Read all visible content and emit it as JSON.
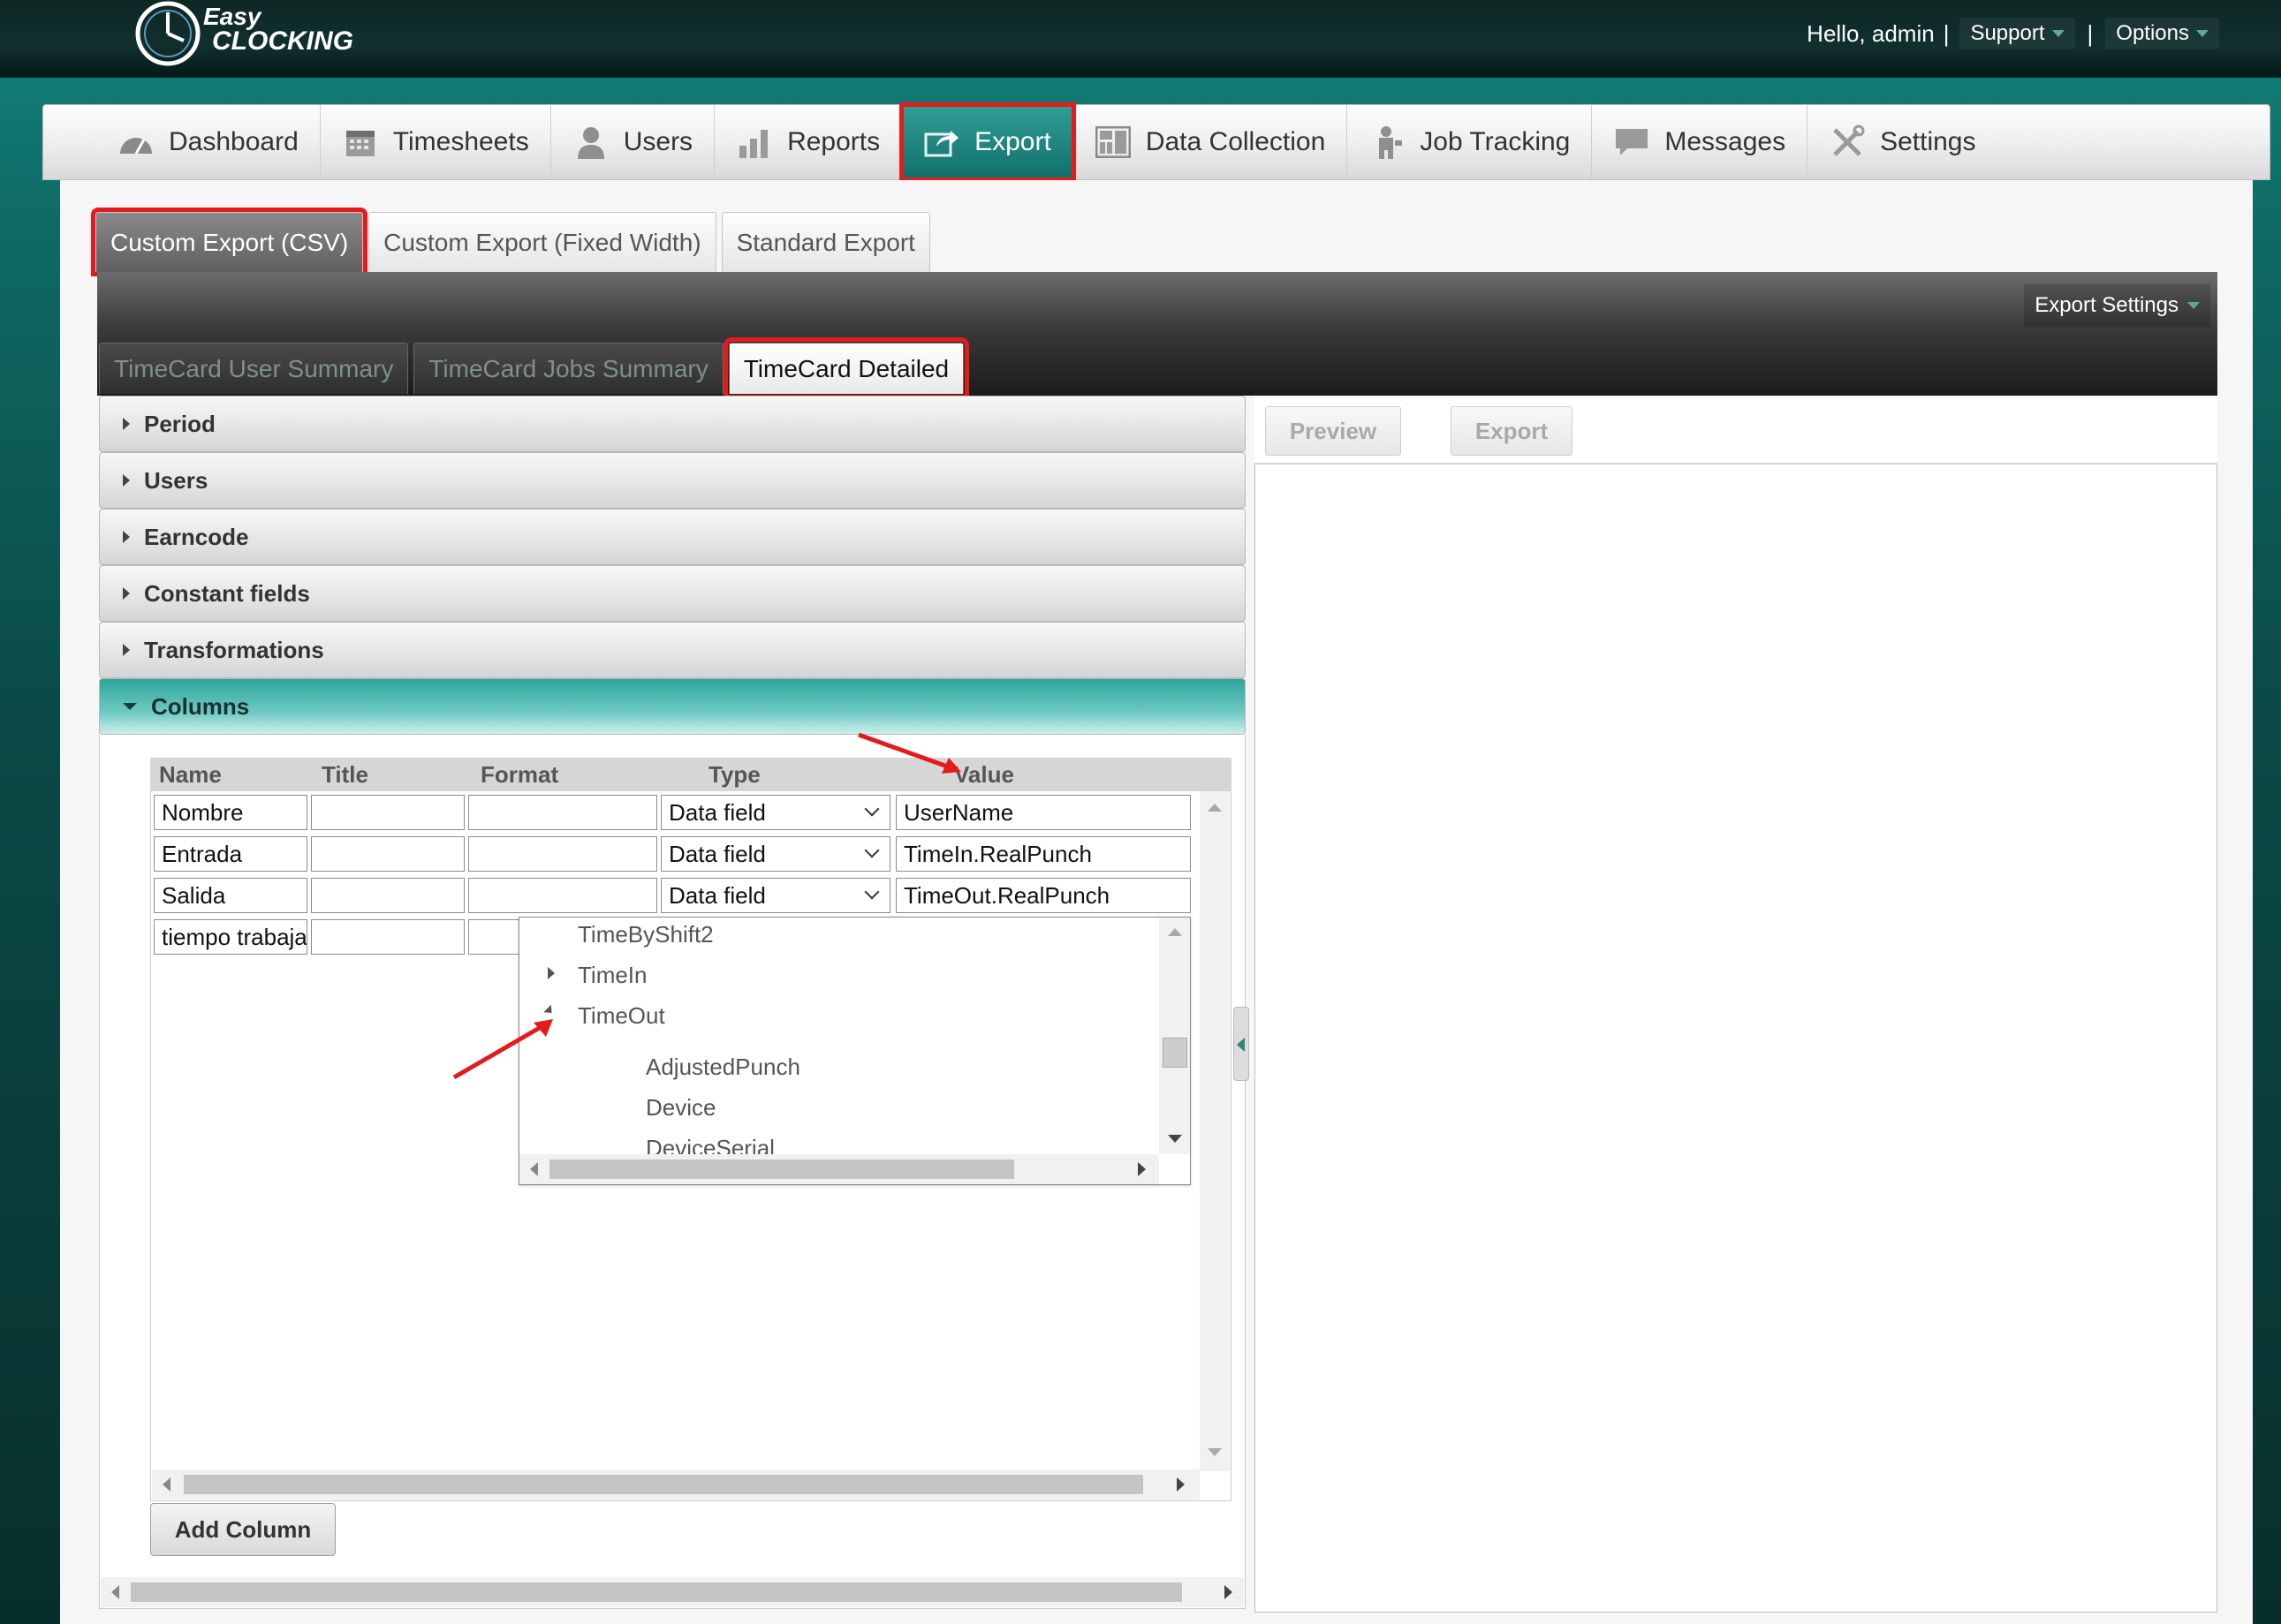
{
  "header": {
    "logo_text_line1": "Easy",
    "logo_text_line2": "CLOCKING",
    "greeting": "Hello, admin",
    "separator": "|",
    "support_label": "Support",
    "options_label": "Options"
  },
  "nav": {
    "items": [
      {
        "label": "Dashboard",
        "icon": "gauge-icon"
      },
      {
        "label": "Timesheets",
        "icon": "calendar-icon"
      },
      {
        "label": "Users",
        "icon": "user-icon"
      },
      {
        "label": "Reports",
        "icon": "bar-chart-icon"
      },
      {
        "label": "Export",
        "icon": "export-icon",
        "active": true
      },
      {
        "label": "Data Collection",
        "icon": "grid-icon"
      },
      {
        "label": "Job Tracking",
        "icon": "worker-icon"
      },
      {
        "label": "Messages",
        "icon": "chat-icon"
      },
      {
        "label": "Settings",
        "icon": "tools-icon"
      }
    ]
  },
  "export_tabs": [
    {
      "label": "Custom Export (CSV)",
      "active": true
    },
    {
      "label": "Custom Export (Fixed Width)"
    },
    {
      "label": "Standard Export"
    }
  ],
  "export_settings_label": "Export Settings",
  "sub_tabs": [
    {
      "label": "TimeCard User Summary"
    },
    {
      "label": "TimeCard Jobs Summary"
    },
    {
      "label": "TimeCard Detailed",
      "active": true
    }
  ],
  "accordion": {
    "sections": [
      "Period",
      "Users",
      "Earncode",
      "Constant fields",
      "Transformations",
      "Columns"
    ],
    "open_section": "Columns"
  },
  "columns_grid": {
    "headers": [
      "Name",
      "Title",
      "Format",
      "Type",
      "Value"
    ],
    "rows": [
      {
        "name": "Nombre",
        "title": "",
        "format": "",
        "type": "Data field",
        "value": "UserName"
      },
      {
        "name": "Entrada",
        "title": "",
        "format": "",
        "type": "Data field",
        "value": "TimeIn.RealPunch"
      },
      {
        "name": "Salida",
        "title": "",
        "format": "",
        "type": "Data field",
        "value": "TimeOut.RealPunch"
      },
      {
        "name": "tiempo trabaja",
        "title": "",
        "format": "",
        "type": "",
        "value": ""
      }
    ],
    "add_column_label": "Add Column"
  },
  "tree_dropdown": {
    "items": [
      {
        "label": "TimeByShift2",
        "level": 0,
        "state": "leaf"
      },
      {
        "label": "TimeIn",
        "level": 0,
        "state": "collapsed"
      },
      {
        "label": "TimeOut",
        "level": 0,
        "state": "expanded"
      },
      {
        "label": "AdjustedPunch",
        "level": 1,
        "state": "leaf"
      },
      {
        "label": "Device",
        "level": 1,
        "state": "leaf"
      },
      {
        "label": "DeviceSerial",
        "level": 1,
        "state": "leaf"
      }
    ]
  },
  "right_panel": {
    "preview_label": "Preview",
    "export_label": "Export"
  },
  "colors": {
    "accent_teal": "#1a8f87",
    "highlight_red": "#e41b1b"
  }
}
